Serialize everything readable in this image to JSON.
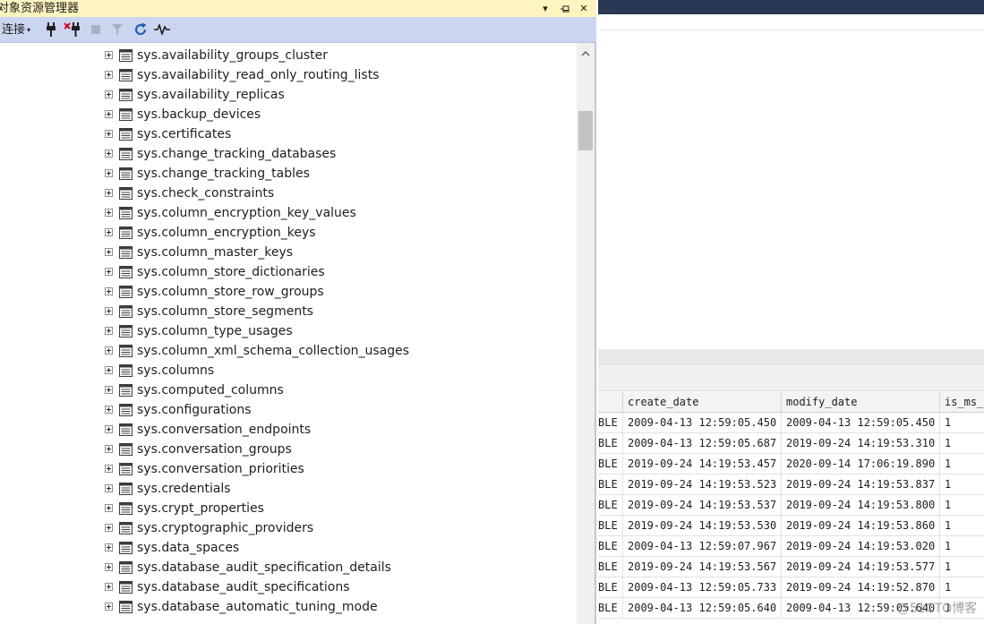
{
  "explorer": {
    "title": "对象资源管理器",
    "title_buttons": {
      "dropdown": "▾",
      "pin": "⊓",
      "close": "✕"
    },
    "toolbar": {
      "connect_label": "连接",
      "connect_caret": "▾"
    },
    "tree_items": [
      "sys.availability_groups_cluster",
      "sys.availability_read_only_routing_lists",
      "sys.availability_replicas",
      "sys.backup_devices",
      "sys.certificates",
      "sys.change_tracking_databases",
      "sys.change_tracking_tables",
      "sys.check_constraints",
      "sys.column_encryption_key_values",
      "sys.column_encryption_keys",
      "sys.column_master_keys",
      "sys.column_store_dictionaries",
      "sys.column_store_row_groups",
      "sys.column_store_segments",
      "sys.column_type_usages",
      "sys.column_xml_schema_collection_usages",
      "sys.columns",
      "sys.computed_columns",
      "sys.configurations",
      "sys.conversation_endpoints",
      "sys.conversation_groups",
      "sys.conversation_priorities",
      "sys.credentials",
      "sys.crypt_properties",
      "sys.cryptographic_providers",
      "sys.data_spaces",
      "sys.database_audit_specification_details",
      "sys.database_audit_specifications",
      "sys.database_automatic_tuning_mode"
    ]
  },
  "results": {
    "columns": [
      "",
      "create_date",
      "modify_date",
      "is_ms_s"
    ],
    "rows": [
      [
        "BLE",
        "2009-04-13 12:59:05.450",
        "2009-04-13 12:59:05.450",
        "1"
      ],
      [
        "BLE",
        "2009-04-13 12:59:05.687",
        "2019-09-24 14:19:53.310",
        "1"
      ],
      [
        "BLE",
        "2019-09-24 14:19:53.457",
        "2020-09-14 17:06:19.890",
        "1"
      ],
      [
        "BLE",
        "2019-09-24 14:19:53.523",
        "2019-09-24 14:19:53.837",
        "1"
      ],
      [
        "BLE",
        "2019-09-24 14:19:53.537",
        "2019-09-24 14:19:53.800",
        "1"
      ],
      [
        "BLE",
        "2019-09-24 14:19:53.530",
        "2019-09-24 14:19:53.860",
        "1"
      ],
      [
        "BLE",
        "2009-04-13 12:59:07.967",
        "2019-09-24 14:19:53.020",
        "1"
      ],
      [
        "BLE",
        "2019-09-24 14:19:53.567",
        "2019-09-24 14:19:53.577",
        "1"
      ],
      [
        "BLE",
        "2009-04-13 12:59:05.733",
        "2019-09-24 14:19:52.870",
        "1"
      ],
      [
        "BLE",
        "2009-04-13 12:59:05.640",
        "2009-04-13 12:59:05.640",
        "1"
      ]
    ]
  },
  "watermark": "@51CTO博客",
  "icons": {
    "connect-plug": "plug-icon",
    "disconnect": "disconnect-icon",
    "stop": "stop-icon",
    "filter": "filter-icon",
    "refresh": "refresh-icon",
    "activity": "activity-monitor-icon",
    "view": "view-table-icon",
    "expander": "expand-plus-icon"
  },
  "colors": {
    "title_bar": "#fdf4bf",
    "toolbar": "#ccd5f0",
    "top_bar": "#293955",
    "refresh_blue": "#1f5fb4",
    "disconnect_red": "#d0021b"
  }
}
